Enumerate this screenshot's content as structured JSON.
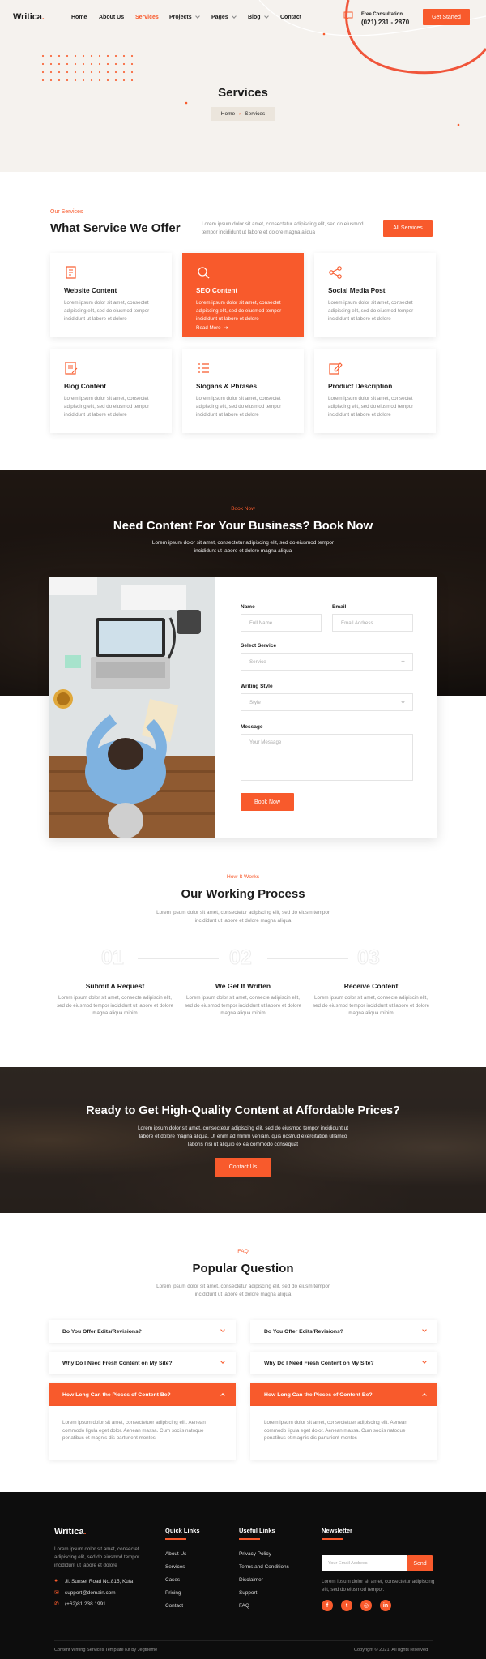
{
  "brand": {
    "logo": "Writica",
    "logo_dot": ".",
    "accent": "#f85a2c",
    "dark": "#0d0d0d",
    "hero_bg": "#f5f2ee"
  },
  "nav": {
    "items": [
      {
        "label": "Home",
        "active": false,
        "dropdown": false
      },
      {
        "label": "About Us",
        "active": false,
        "dropdown": false
      },
      {
        "label": "Services",
        "active": true,
        "dropdown": false
      },
      {
        "label": "Projects",
        "active": false,
        "dropdown": true
      },
      {
        "label": "Pages",
        "active": false,
        "dropdown": true
      },
      {
        "label": "Blog",
        "active": false,
        "dropdown": true
      },
      {
        "label": "Contact",
        "active": false,
        "dropdown": false
      }
    ],
    "consult_label": "Free Consultation",
    "consult_phone": "(021) 231 - 2870",
    "cta": "Get Started"
  },
  "hero": {
    "title": "Services",
    "breadcrumb_home": "Home",
    "breadcrumb_current": "Services"
  },
  "services": {
    "eyebrow": "Our Services",
    "title": "What Service We Offer",
    "intro": "Lorem ipsum dolor sit amet, consectetur adipiscing elit, sed do eiusmod tempor incididunt ut labore et dolore magna aliqua",
    "button": "All Services",
    "cards": [
      {
        "icon": "document-icon",
        "title": "Website Content",
        "desc": "Lorem ipsum dolor sit amet, consectet adipiscing elit, sed do eiusmod tempor incididunt ut labore et dolore",
        "highlight": false
      },
      {
        "icon": "seo-icon",
        "title": "SEO Content",
        "desc": "Lorem ipsum dolor sit amet, consectet adipiscing elit, sed do eiusmod tempor incididunt ut labore et dolore",
        "highlight": true,
        "link": "Read More"
      },
      {
        "icon": "share-icon",
        "title": "Social Media Post",
        "desc": "Lorem ipsum dolor sit amet, consectet adipiscing elit, sed do eiusmod tempor incididunt ut labore et dolore",
        "highlight": false
      },
      {
        "icon": "blog-icon",
        "title": "Blog Content",
        "desc": "Lorem ipsum dolor sit amet, consectet adipiscing elit, sed do eiusmod tempor incididunt ut labore et dolore",
        "highlight": false
      },
      {
        "icon": "list-icon",
        "title": "Slogans & Phrases",
        "desc": "Lorem ipsum dolor sit amet, consectet adipiscing elit, sed do eiusmod tempor incididunt ut labore et dolore",
        "highlight": false
      },
      {
        "icon": "edit-icon",
        "title": "Product Description",
        "desc": "Lorem ipsum dolor sit amet, consectet adipiscing elit, sed do eiusmod tempor incididunt ut labore et dolore",
        "highlight": false
      }
    ]
  },
  "booking": {
    "eyebrow": "Book Now",
    "title": "Need Content For Your Business? Book Now",
    "desc": "Lorem ipsum dolor sit amet, consectetur adipiscing elit, sed do eiusmod tempor incididunt ut labore et dolore magna aliqua",
    "name_label": "Name",
    "name_placeholder": "Full Name",
    "email_label": "Email",
    "email_placeholder": "Email Address",
    "service_label": "Select Service",
    "service_value": "Service",
    "style_label": "Writing Style",
    "style_value": "Style",
    "message_label": "Message",
    "message_placeholder": "Your Message",
    "submit": "Book Now"
  },
  "process": {
    "eyebrow": "How It Works",
    "title": "Our Working Process",
    "desc": "Lorem ipsum dolor sit amet, consectetur adipiscing elit, sed do eiusm tempor incididunt ut labore et dolore magna aliqua",
    "steps": [
      {
        "num": "01",
        "title": "Submit A Request",
        "desc": "Lorem ipsum dolor sit amet, consecte adipiscin elit, sed do eiusmod tempor incididunt ut labore et dolore magna aliqua minim"
      },
      {
        "num": "02",
        "title": "We Get It Written",
        "desc": "Lorem ipsum dolor sit amet, consecte adipiscin elit, sed do eiusmod tempor incididunt ut labore et dolore magna aliqua minim"
      },
      {
        "num": "03",
        "title": "Receive Content",
        "desc": "Lorem ipsum dolor sit amet, consecte adipiscin elit, sed do eiusmod tempor incididunt ut labore et dolore magna aliqua minim"
      }
    ]
  },
  "cta": {
    "title": "Ready to Get High-Quality Content at Affordable Prices?",
    "desc1": "Lorem ipsum dolor sit amet, consectetur adipiscing elit, sed do eiusmod tempor incididunt ut",
    "desc2": "labore et dolore magna aliqua. Ut enim ad minim veniam, quis nostrud exercitation ullamco",
    "desc3": "laboris nisi ut aliquip ex ea commodo consequat",
    "button": "Contact Us"
  },
  "faq": {
    "eyebrow": "FAQ",
    "title": "Popular Question",
    "desc": "Lorem ipsum dolor sit amet, consectetur adipiscing elit, sed do eiusm tempor incididunt ut labore et dolore magna aliqua",
    "left": [
      {
        "q": "Do You Offer Edits/Revisions?",
        "open": false
      },
      {
        "q": "Why Do I Need Fresh Content on My Site?",
        "open": false
      },
      {
        "q": "How Long Can the Pieces of Content Be?",
        "open": true,
        "a": "Lorem ipsum dolor sit amet, consectetuer adipiscing elit. Aenean commodo ligula eget dolor. Aenean massa. Cum sociis natoque penatibus et magnis dis parturient montes"
      }
    ],
    "right": [
      {
        "q": "Do You Offer Edits/Revisions?",
        "open": false
      },
      {
        "q": "Why Do I Need Fresh Content on My Site?",
        "open": false
      },
      {
        "q": "How Long Can the Pieces of Content Be?",
        "open": true,
        "a": "Lorem ipsum dolor sit amet, consectetuer adipiscing elit. Aenean commodo ligula eget dolor. Aenean massa. Cum sociis natoque penatibus et magnis dis parturient montes"
      }
    ]
  },
  "footer": {
    "logo": "Writica",
    "about": "Lorem ipsum dolor sit amet, consectet adipiscing elit, sed do eiusmod tempor incididunt ut labore et dolore",
    "address": "Jl. Sunset Road No.815, Kuta",
    "email": "support@domain.com",
    "phone": "(+62)81 238 1991",
    "quick_title": "Quick Links",
    "quick_links": [
      "About Us",
      "Services",
      "Cases",
      "Pricing",
      "Contact"
    ],
    "useful_title": "Useful Links",
    "useful_links": [
      "Privacy Policy",
      "Terms and Conditions",
      "Disclaimer",
      "Support",
      "FAQ"
    ],
    "newsletter_title": "Newsletter",
    "newsletter_placeholder": "Your Email Address",
    "newsletter_button": "Send",
    "newsletter_desc": "Lorem ipsum dolor sit amet, consectetur adipiscing elit, sed do eiusmod tempor.",
    "socials": [
      {
        "icon": "facebook-icon",
        "glyph": "f"
      },
      {
        "icon": "twitter-icon",
        "glyph": "t"
      },
      {
        "icon": "instagram-icon",
        "glyph": "◎"
      },
      {
        "icon": "linkedin-icon",
        "glyph": "in"
      }
    ],
    "credit": "Content Writing Services Template Kit by Jegtheme",
    "copyright": "Copyright © 2021. All rights reserved"
  }
}
